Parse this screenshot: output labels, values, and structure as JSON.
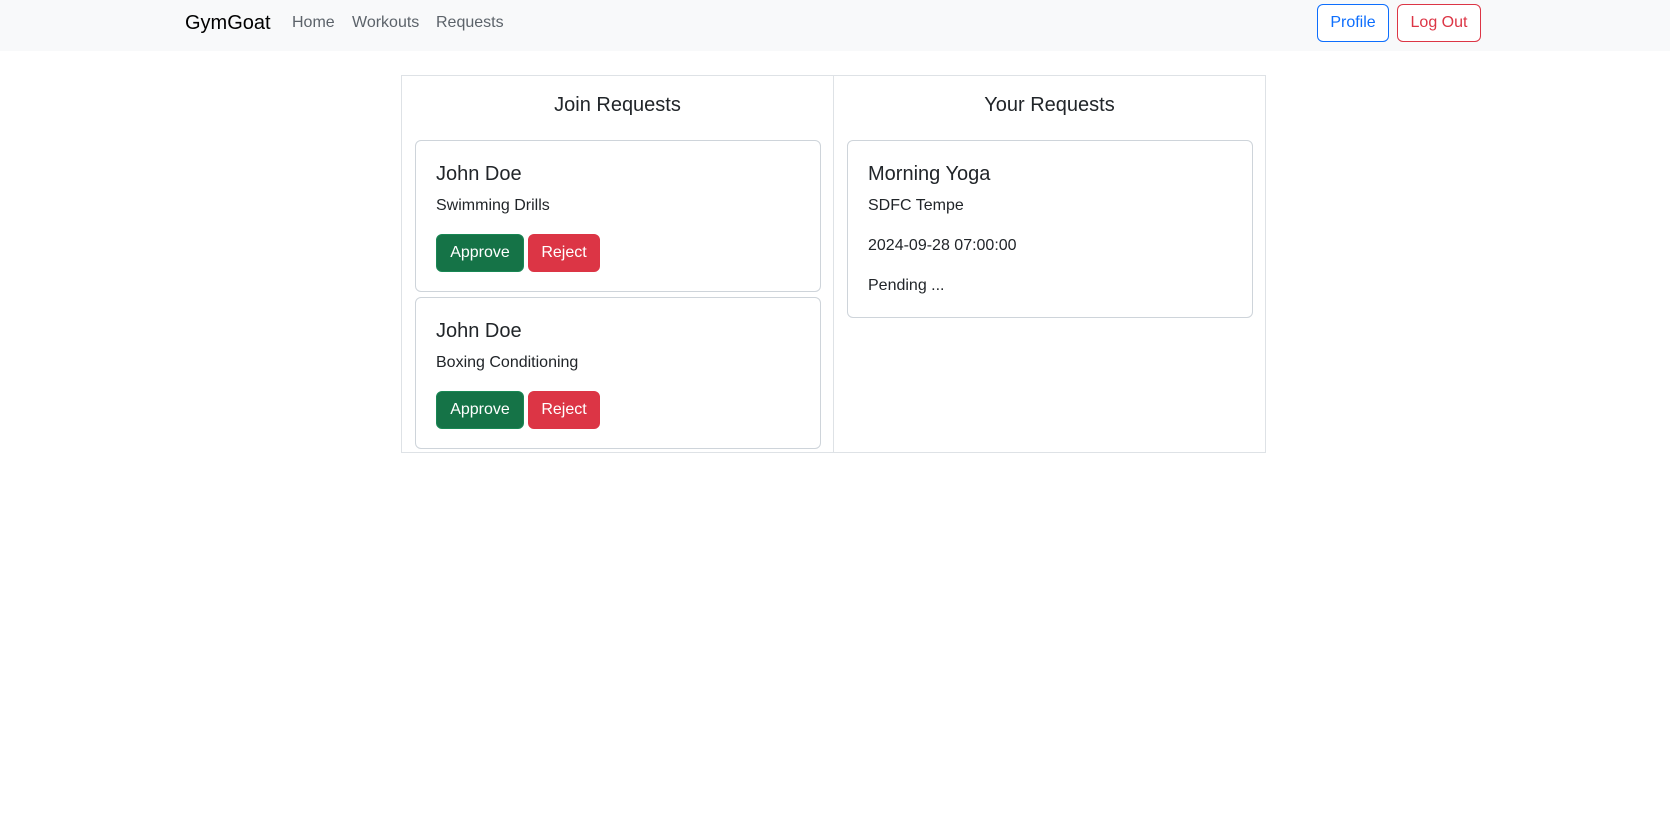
{
  "navbar": {
    "brand": "GymGoat",
    "links": [
      "Home",
      "Workouts",
      "Requests"
    ],
    "profile_label": "Profile",
    "logout_label": "Log Out"
  },
  "join_requests": {
    "title": "Join Requests",
    "items": [
      {
        "name": "John Doe",
        "workout": "Swimming Drills",
        "approve_label": "Approve",
        "reject_label": "Reject"
      },
      {
        "name": "John Doe",
        "workout": "Boxing Conditioning",
        "approve_label": "Approve",
        "reject_label": "Reject"
      }
    ]
  },
  "your_requests": {
    "title": "Your Requests",
    "items": [
      {
        "workout": "Morning Yoga",
        "location": "SDFC Tempe",
        "datetime": "2024-09-28 07:00:00",
        "status": "Pending ..."
      }
    ]
  },
  "colors": {
    "navbar_bg": "#f8f9fa",
    "primary": "#0d6efd",
    "danger": "#dc3545",
    "success": "#157347",
    "border": "#dee2e6"
  }
}
